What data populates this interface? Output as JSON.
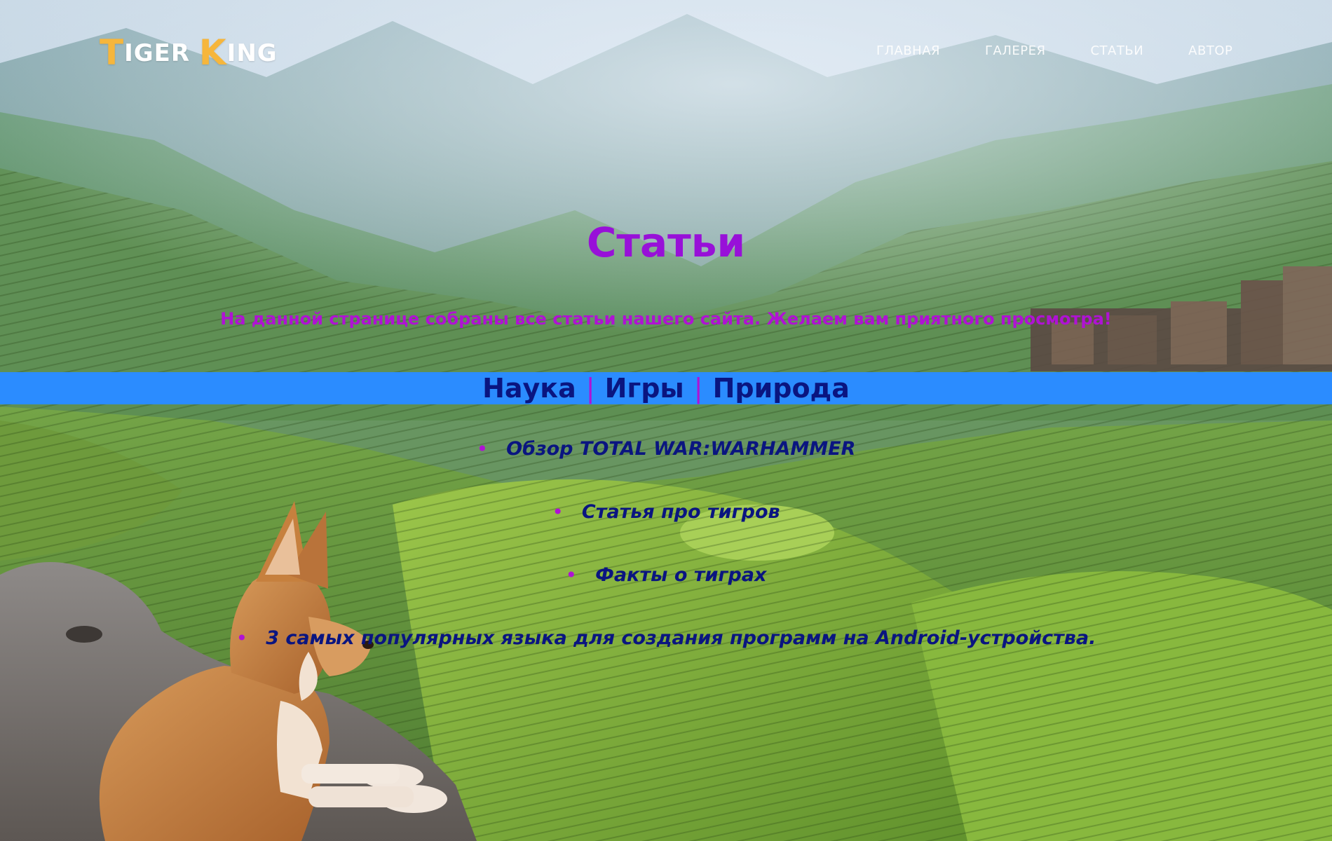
{
  "header": {
    "logo": {
      "first_cap": "T",
      "first_rest": "IGER",
      "second_cap": "K",
      "second_rest": "ING"
    },
    "nav": [
      "ГЛАВНАЯ",
      "ГАЛЕРЕЯ",
      "СТАТЬИ",
      "АВТОР"
    ]
  },
  "main": {
    "title": "Статьи",
    "subtitle": "На данной странице собраны все статьи нашего сайта. Желаем вам приятного просмотра!"
  },
  "categories": {
    "items": [
      "Наука",
      "Игры",
      "Природа"
    ],
    "separator": "|"
  },
  "articles": [
    "Обзор TOTAL WAR:WARHAMMER",
    "Статья про тигров",
    "Факты о тиграх",
    "3 самых популярных языка для создания программ на Android-устройства."
  ],
  "colors": {
    "accent": "#9810d8",
    "subtitle": "#b012d4",
    "category_bar": "#2b8cff",
    "link": "#0a1580",
    "logo_accent": "#f6b63c"
  }
}
